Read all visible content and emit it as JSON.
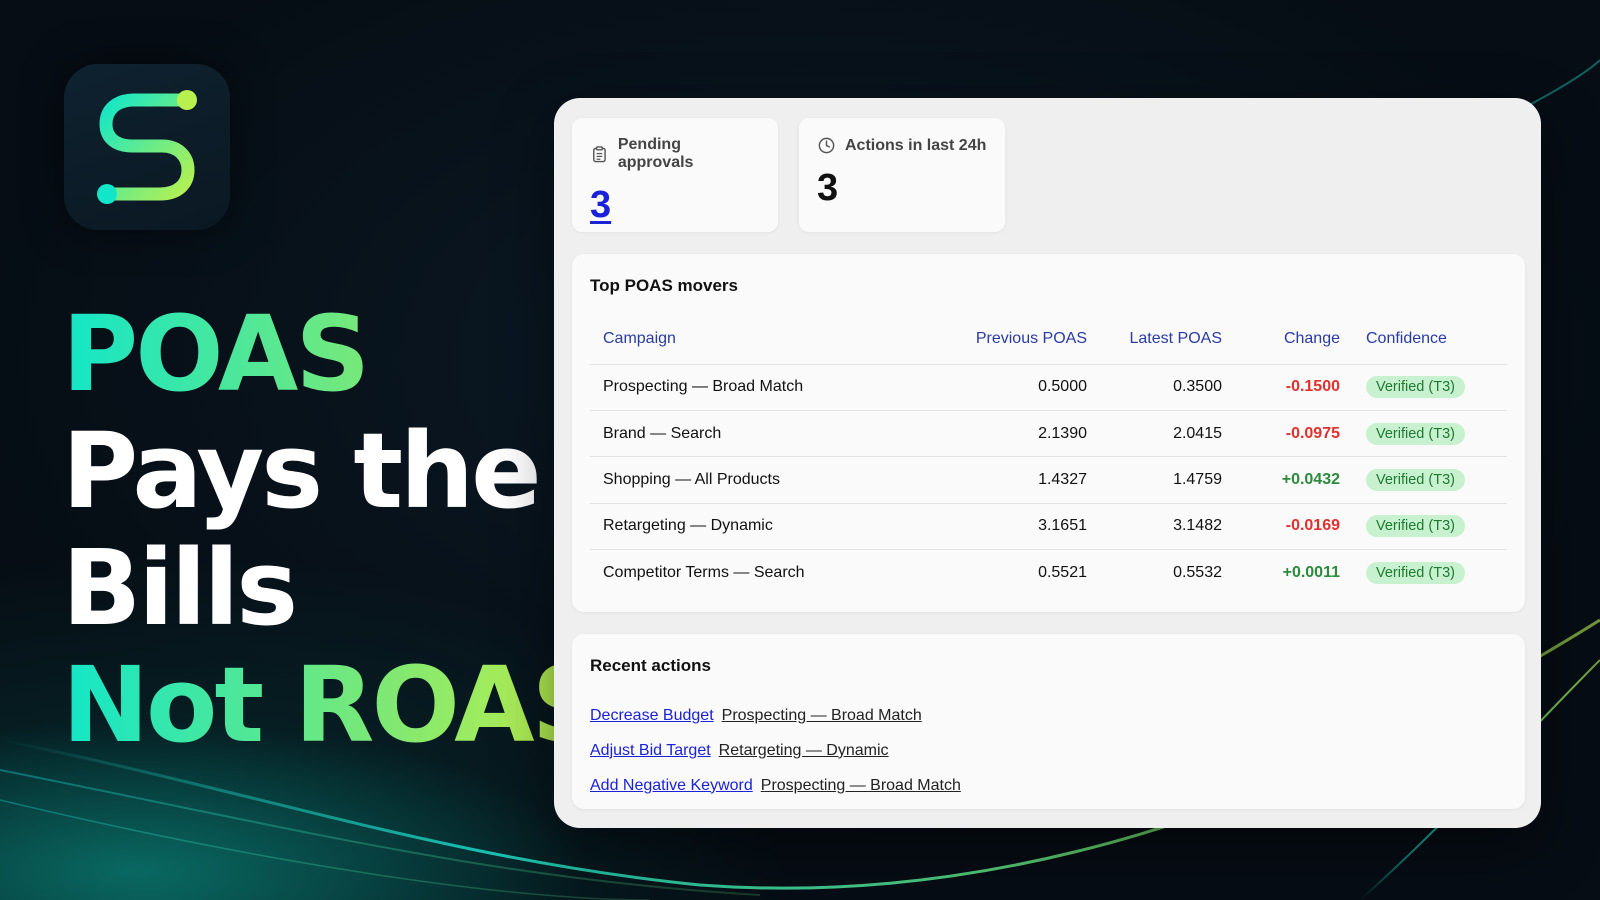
{
  "headline": {
    "line1": "POAS",
    "line2": "Pays the",
    "line3": "Bills",
    "line4": "Not ROAS"
  },
  "colors": {
    "accent_teal": "#12e6c8",
    "accent_lime": "#c6f045",
    "link_blue": "#1a22d8",
    "negative_red": "#e0312e",
    "positive_green": "#2c8a3b",
    "badge_bg": "#c8f2cf"
  },
  "stats": {
    "pending": {
      "label": "Pending approvals",
      "value": "3",
      "icon": "clipboard-icon"
    },
    "actions24h": {
      "label": "Actions in last 24h",
      "value": "3",
      "icon": "clock-icon"
    }
  },
  "movers": {
    "title": "Top POAS movers",
    "columns": {
      "campaign": "Campaign",
      "previous": "Previous POAS",
      "latest": "Latest POAS",
      "change": "Change",
      "confidence": "Confidence"
    },
    "rows": [
      {
        "campaign": "Prospecting — Broad Match",
        "previous": "0.5000",
        "latest": "0.3500",
        "change": "-0.1500",
        "confidence": "Verified (T3)"
      },
      {
        "campaign": "Brand — Search",
        "previous": "2.1390",
        "latest": "2.0415",
        "change": "-0.0975",
        "confidence": "Verified (T3)"
      },
      {
        "campaign": "Shopping — All Products",
        "previous": "1.4327",
        "latest": "1.4759",
        "change": "+0.0432",
        "confidence": "Verified (T3)"
      },
      {
        "campaign": "Retargeting — Dynamic",
        "previous": "3.1651",
        "latest": "3.1482",
        "change": "-0.0169",
        "confidence": "Verified (T3)"
      },
      {
        "campaign": "Competitor Terms — Search",
        "previous": "0.5521",
        "latest": "0.5532",
        "change": "+0.0011",
        "confidence": "Verified (T3)"
      }
    ]
  },
  "recent": {
    "title": "Recent actions",
    "items": [
      {
        "action": "Decrease Budget",
        "target": "Prospecting — Broad Match"
      },
      {
        "action": "Adjust Bid Target",
        "target": "Retargeting — Dynamic"
      },
      {
        "action": "Add Negative Keyword",
        "target": "Prospecting — Broad Match"
      }
    ]
  }
}
